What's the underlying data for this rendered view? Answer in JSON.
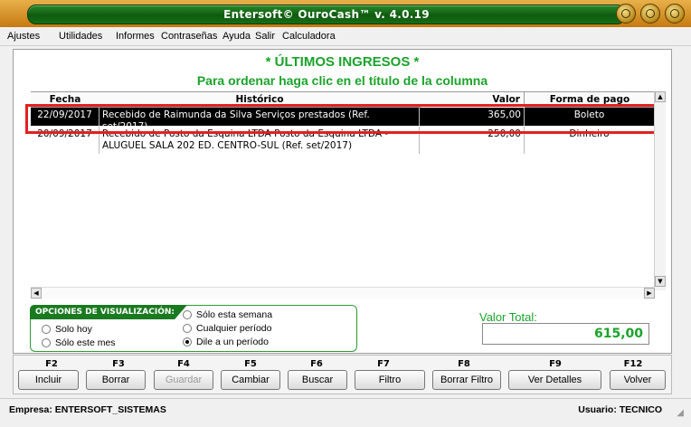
{
  "window": {
    "title": "Entersoft© OuroCash™ v. 4.0.19"
  },
  "menu": [
    "Ajustes",
    "Utilidades",
    "Informes",
    "Contraseñas",
    "Ayuda",
    "Salir",
    "Calculadora"
  ],
  "headings": {
    "title": "* ÚLTIMOS INGRESOS *",
    "subtitle": "Para ordenar haga clic en el título de la columna"
  },
  "table": {
    "columns": [
      "Fecha",
      "Histórico",
      "Valor",
      "Forma de pago"
    ],
    "rows": [
      {
        "fecha": "22/09/2017",
        "historico": "Recebido de Raimunda da Silva Serviços prestados (Ref. set/2017)",
        "valor": "365,00",
        "forma": "Boleto",
        "selected": true
      },
      {
        "fecha": "20/09/2017",
        "historico": "Recebido de Posto da Esquina LTDA Posto da Esquina LTDA - ALUGUEL SALA 202 ED. CENTRO-SUL (Ref. set/2017)",
        "valor": "250,00",
        "forma": "Dinheiro",
        "selected": false
      }
    ]
  },
  "options": {
    "label": "OPCIONES DE VISUALIZACIÓN:",
    "items": [
      {
        "label": "Solo hoy",
        "checked": false
      },
      {
        "label": "Sólo este mes",
        "checked": false
      },
      {
        "label": "Sólo esta semana",
        "checked": false
      },
      {
        "label": "Cualquier período",
        "checked": false
      },
      {
        "label": "Dile a un período",
        "checked": true
      }
    ]
  },
  "total": {
    "label": "Valor Total:",
    "value": "615,00"
  },
  "fkeys": [
    {
      "key": "F2",
      "label": "Incluir",
      "enabled": true
    },
    {
      "key": "F3",
      "label": "Borrar",
      "enabled": true
    },
    {
      "key": "F4",
      "label": "Guardar",
      "enabled": false
    },
    {
      "key": "F5",
      "label": "Cambiar",
      "enabled": true
    },
    {
      "key": "F6",
      "label": "Buscar",
      "enabled": true
    },
    {
      "key": "F7",
      "label": "Filtro",
      "enabled": true
    },
    {
      "key": "F8",
      "label": "Borrar Filtro",
      "enabled": true
    },
    {
      "key": "F9",
      "label": "Ver Detalles",
      "enabled": true
    },
    {
      "key": "F12",
      "label": "Volver",
      "enabled": true
    }
  ],
  "status": {
    "empresa": "Empresa: ENTERSOFT_SISTEMAS",
    "usuario": "Usuario: TECNICO"
  },
  "colors": {
    "accent_green": "#1aa32a",
    "title_orange": "#d98a1a",
    "highlight_red": "#e32020"
  }
}
